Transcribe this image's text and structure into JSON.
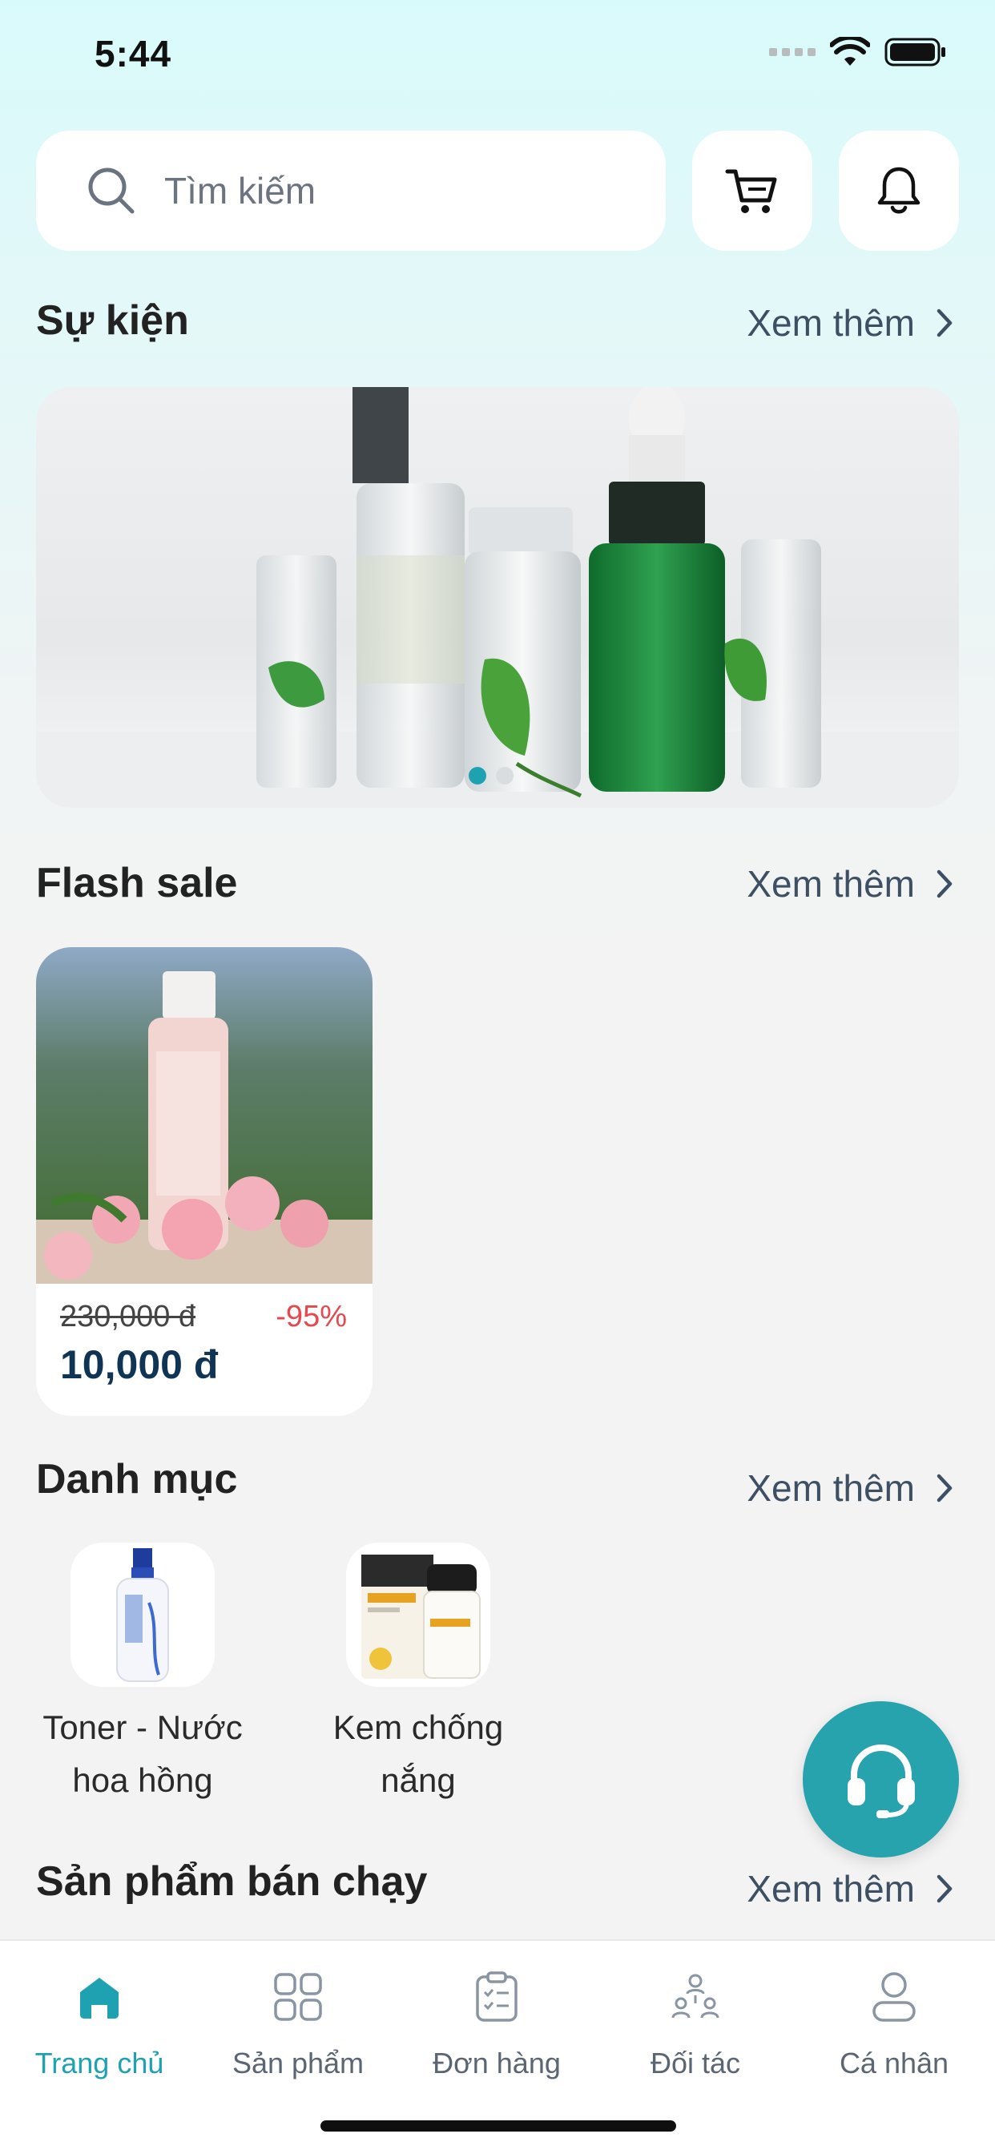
{
  "status_bar": {
    "time": "5:44"
  },
  "search": {
    "placeholder": "Tìm kiếm"
  },
  "sections": {
    "events": {
      "title": "Sự kiện",
      "see_more": "Xem thêm"
    },
    "flash_sale": {
      "title": "Flash sale",
      "see_more": "Xem thêm"
    },
    "categories": {
      "title": "Danh mục",
      "see_more": "Xem thêm"
    },
    "best_sellers": {
      "title": "Sản phẩm bán chạy",
      "see_more": "Xem thêm"
    }
  },
  "flash_sale_items": [
    {
      "old_price": "230,000 đ",
      "discount": "-95%",
      "price": "10,000 đ"
    }
  ],
  "categories": [
    {
      "line1": "Toner - Nước",
      "line2": "hoa hồng"
    },
    {
      "line1": "Kem chống",
      "line2": "nắng"
    }
  ],
  "tabbar": {
    "items": [
      {
        "label": "Trang chủ",
        "icon": "home-icon",
        "active": true
      },
      {
        "label": "Sản phẩm",
        "icon": "grid-icon",
        "active": false
      },
      {
        "label": "Đơn hàng",
        "icon": "clipboard-icon",
        "active": false
      },
      {
        "label": "Đối tác",
        "icon": "partners-icon",
        "active": false
      },
      {
        "label": "Cá nhân",
        "icon": "user-icon",
        "active": false
      }
    ]
  },
  "colors": {
    "accent": "#1ea2b2",
    "fab": "#27a3ae",
    "price": "#0f3454",
    "discount": "#e5484d"
  }
}
